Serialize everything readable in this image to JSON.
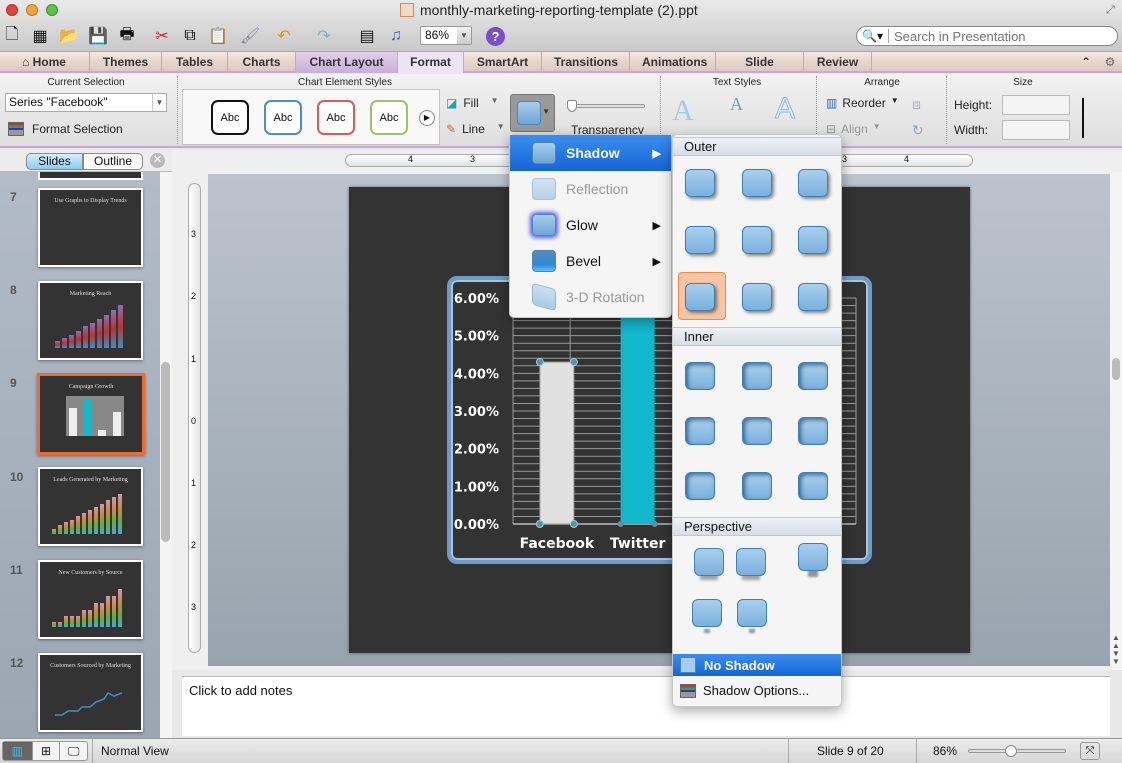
{
  "window": {
    "title": "monthly-marketing-reporting-template (2).ppt"
  },
  "toolbar": {
    "icons": [
      "new-icon",
      "gallery-icon",
      "open-icon",
      "save-icon",
      "print-icon",
      "cut-icon",
      "copy-icon",
      "paste-icon",
      "format-painter-icon",
      "undo-icon",
      "redo-icon",
      "insert-slide-icon",
      "media-icon",
      "help-icon"
    ],
    "zoom": "86%",
    "search_placeholder": "Search in Presentation"
  },
  "tabs": [
    {
      "label": "Home",
      "icon": "home-icon"
    },
    {
      "label": "Themes"
    },
    {
      "label": "Tables"
    },
    {
      "label": "Charts"
    },
    {
      "label": "Chart Layout",
      "contextual": true
    },
    {
      "label": "Format",
      "contextual": true,
      "active": true
    },
    {
      "label": "SmartArt"
    },
    {
      "label": "Transitions"
    },
    {
      "label": "Animations"
    },
    {
      "label": "Slide Show"
    },
    {
      "label": "Review"
    }
  ],
  "ribbon": {
    "current_selection": {
      "title": "Current Selection",
      "value": "Series \"Facebook\"",
      "format_selection": "Format Selection"
    },
    "chart_element_styles": {
      "title": "Chart Element Styles",
      "styles": [
        "Abc",
        "Abc",
        "Abc",
        "Abc"
      ],
      "style_colors": [
        "#111111",
        "#4a90c8",
        "#d85a5a",
        "#9cc26a"
      ],
      "fill": "Fill",
      "line": "Line",
      "transparency": "Transparency"
    },
    "text_styles": {
      "title": "Text Styles"
    },
    "arrange": {
      "title": "Arrange",
      "reorder": "Reorder",
      "align": "Align"
    },
    "size": {
      "title": "Size",
      "height_label": "Height:",
      "width_label": "Width:",
      "height_value": "",
      "width_value": ""
    }
  },
  "panel": {
    "tabs": [
      "Slides",
      "Outline"
    ],
    "active_tab": "Slides",
    "slides": [
      {
        "num": "7",
        "title": "Use Graphs to Display Trends"
      },
      {
        "num": "8",
        "title": "Marketing Reach"
      },
      {
        "num": "9",
        "title": "Campaign Growth",
        "selected": true
      },
      {
        "num": "10",
        "title": "Leads Generated by Marketing"
      },
      {
        "num": "11",
        "title": "New Customers by Source"
      },
      {
        "num": "12",
        "title": "Customers Sourced by Marketing"
      }
    ]
  },
  "rulers": {
    "horizontal": [
      "4",
      "3",
      "3",
      "4"
    ],
    "vertical": [
      "3",
      "2",
      "1",
      "0",
      "1",
      "2",
      "3"
    ]
  },
  "slide": {
    "title": "Campaign Growth"
  },
  "chart_data": {
    "type": "bar",
    "categories": [
      "Facebook",
      "Twitter"
    ],
    "values": [
      0.043,
      0.058
    ],
    "bar_colors": [
      "#e0e0e0",
      "#12b8cc"
    ],
    "selected_series": "Facebook",
    "ylim": [
      0,
      0.06
    ],
    "yticks": [
      "0.00%",
      "1.00%",
      "2.00%",
      "3.00%",
      "4.00%",
      "5.00%",
      "6.00%"
    ],
    "grid": true,
    "title": "",
    "xlabel": "",
    "ylabel": ""
  },
  "effects_menu": {
    "items": [
      {
        "label": "Shadow",
        "highlighted": true,
        "submenu": true
      },
      {
        "label": "Reflection",
        "disabled": true
      },
      {
        "label": "Glow",
        "submenu": true
      },
      {
        "label": "Bevel",
        "submenu": true
      },
      {
        "label": "3-D Rotation",
        "disabled": true
      }
    ]
  },
  "shadow_menu": {
    "sections": [
      "Outer",
      "Inner",
      "Perspective"
    ],
    "outer_selected_index": 6,
    "no_shadow": "No Shadow",
    "options": "Shadow Options..."
  },
  "notes": {
    "placeholder": "Click to add notes"
  },
  "status": {
    "view": "Normal View",
    "slide": "Slide 9 of 20",
    "zoom": "86%",
    "zoom_fraction": 0.42
  }
}
